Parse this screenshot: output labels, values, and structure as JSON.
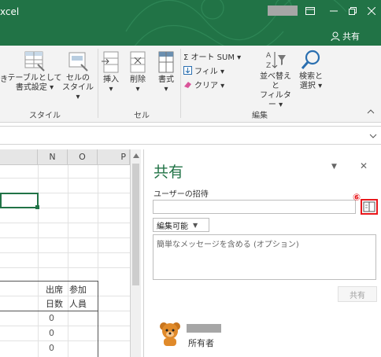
{
  "app": {
    "title": "xcel"
  },
  "window": {
    "share_button": "共有"
  },
  "ribbon": {
    "styles": {
      "conditional_partial": "き",
      "format_as_table_line1": "テーブルとして",
      "format_as_table_line2": "書式設定 ▾",
      "cell_styles_line1": "セルの",
      "cell_styles_line2": "スタイル ▾",
      "group_label": "スタイル"
    },
    "cells": {
      "insert": "挿入",
      "delete": "削除",
      "format": "書式",
      "group_label": "セル"
    },
    "editing": {
      "autosum": "Σ オート SUM ▾",
      "fill": "フィル ▾",
      "clear": "クリア ▾",
      "sort_filter_line1": "並べ替えと",
      "sort_filter_line2": "フィルター ▾",
      "find_select_line1": "検索と",
      "find_select_line2": "選択 ▾",
      "group_label": "編集"
    }
  },
  "sheet": {
    "columns": [
      "N",
      "O",
      "P"
    ],
    "cells": {
      "n_header_1": "出席",
      "o_header_1": "参加",
      "n_header_2": "日数",
      "o_header_2": "人員",
      "zero": "0"
    }
  },
  "share_pane": {
    "title": "共有",
    "invite_label": "ユーザーの招待",
    "step_number": "⑥",
    "permission": "編集可能",
    "message_placeholder": "簡単なメッセージを含める (オプション)",
    "share_button": "共有",
    "owner_role": "所有者"
  },
  "colors": {
    "excel_green": "#217346",
    "highlight_red": "#e8181c"
  }
}
